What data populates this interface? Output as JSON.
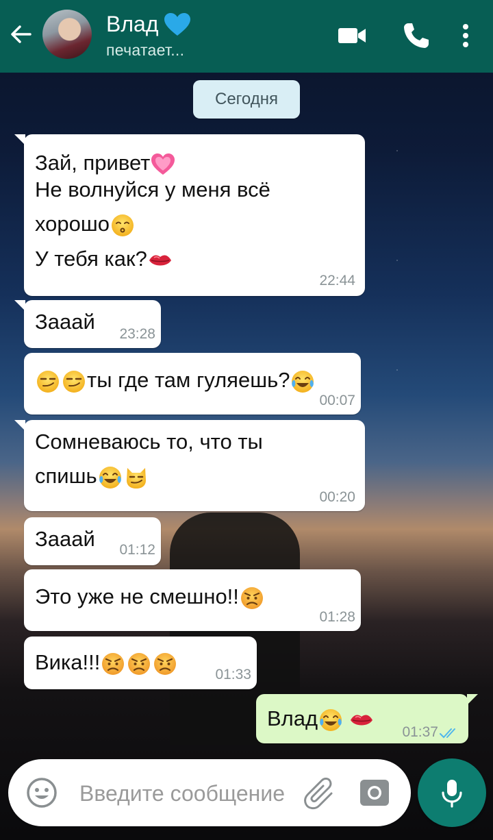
{
  "header": {
    "contact_name": "Влад",
    "status": "печатает...",
    "colors": {
      "bar": "#075e54",
      "heart": "#2aa9e8"
    }
  },
  "date_chip": "Сегодня",
  "messages": [
    {
      "direction": "in",
      "lines": [
        "Зай, привет",
        "Не волнуйся у меня всё",
        "хорошо",
        "У тебя как?"
      ],
      "time": "22:44"
    },
    {
      "direction": "in",
      "lines": [
        "Зааай"
      ],
      "time": "23:28"
    },
    {
      "direction": "in",
      "lines": [
        "ты где там гуляешь?"
      ],
      "time": "00:07"
    },
    {
      "direction": "in",
      "lines": [
        "Сомневаюсь то, что ты",
        "спишь"
      ],
      "time": "00:20"
    },
    {
      "direction": "in",
      "lines": [
        "Зааай"
      ],
      "time": "01:12"
    },
    {
      "direction": "in",
      "lines": [
        "Это уже не смешно!!"
      ],
      "time": "01:28"
    },
    {
      "direction": "in",
      "lines": [
        "Вика!!!"
      ],
      "time": "01:33"
    },
    {
      "direction": "out",
      "lines": [
        "Влад"
      ],
      "time": "01:37",
      "status": "read"
    }
  ],
  "input": {
    "placeholder": "Введите сообщение"
  },
  "icons": [
    "back-arrow-icon",
    "video-call-icon",
    "voice-call-icon",
    "more-options-icon",
    "emoji-icon",
    "attach-icon",
    "camera-icon",
    "mic-icon"
  ]
}
